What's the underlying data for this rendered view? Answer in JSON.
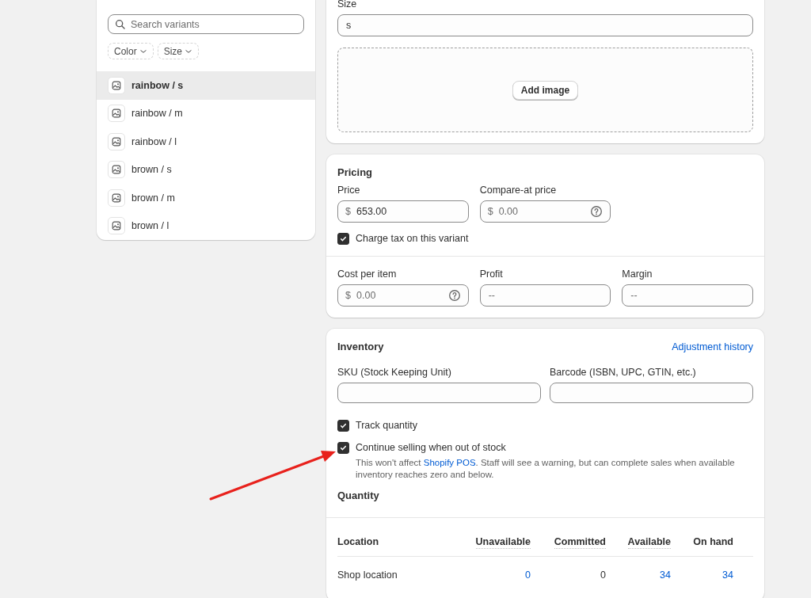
{
  "variants_panel": {
    "search": {
      "placeholder": "Search variants"
    },
    "filters": [
      {
        "label": "Color"
      },
      {
        "label": "Size"
      }
    ],
    "items": [
      {
        "label": "rainbow / s",
        "selected": true
      },
      {
        "label": "rainbow / m",
        "selected": false
      },
      {
        "label": "rainbow / l",
        "selected": false
      },
      {
        "label": "brown / s",
        "selected": false
      },
      {
        "label": "brown / m",
        "selected": false
      },
      {
        "label": "brown / l",
        "selected": false
      }
    ]
  },
  "options_card": {
    "size_label": "Size",
    "size_value": "s",
    "add_image_button": "Add image"
  },
  "pricing": {
    "title": "Pricing",
    "fields": [
      {
        "label": "Price",
        "prefix": "$",
        "value": "653.00",
        "help": false
      },
      {
        "label": "Compare-at price",
        "prefix": "$",
        "placeholder": "0.00",
        "help": true
      }
    ],
    "charge_tax": {
      "label": "Charge tax on this variant",
      "checked": true
    },
    "cost_fields": [
      {
        "label": "Cost per item",
        "prefix": "$",
        "placeholder": "0.00",
        "help": true
      },
      {
        "label": "Profit",
        "placeholder": "--",
        "help": false
      },
      {
        "label": "Margin",
        "placeholder": "--",
        "help": false
      }
    ]
  },
  "inventory": {
    "title": "Inventory",
    "history_link": "Adjustment history",
    "fields": [
      {
        "label": "SKU (Stock Keeping Unit)"
      },
      {
        "label": "Barcode (ISBN, UPC, GTIN, etc.)"
      }
    ],
    "track_quantity": {
      "label": "Track quantity",
      "checked": true
    },
    "continue_selling": {
      "label": "Continue selling when out of stock",
      "checked": true,
      "help_before": "This won't affect ",
      "help_link": "Shopify POS",
      "help_after": ". Staff will see a warning, but can complete sales when available inventory reaches zero and below."
    },
    "quantity_title": "Quantity",
    "table": {
      "columns": [
        {
          "label": "Location",
          "dotted": false
        },
        {
          "label": "Unavailable",
          "dotted": true
        },
        {
          "label": "Committed",
          "dotted": true
        },
        {
          "label": "Available",
          "dotted": true
        },
        {
          "label": "On hand",
          "dotted": false
        }
      ],
      "rows": [
        {
          "cells": [
            {
              "text": "Shop location",
              "link": false
            },
            {
              "text": "0",
              "link": true
            },
            {
              "text": "0",
              "link": false
            },
            {
              "text": "34",
              "link": true
            },
            {
              "text": "34",
              "link": true
            }
          ]
        }
      ]
    }
  },
  "annotations": [
    {
      "kind": "arrow"
    }
  ]
}
